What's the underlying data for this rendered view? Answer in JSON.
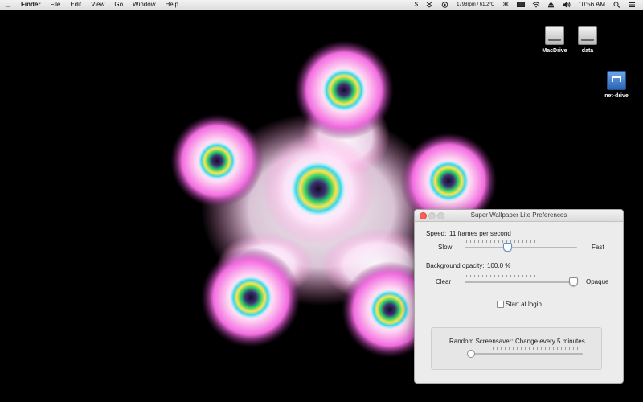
{
  "menubar": {
    "app_name": "Finder",
    "menus": [
      "File",
      "Edit",
      "View",
      "Go",
      "Window",
      "Help"
    ],
    "status": {
      "fan_temp": "1798rpm / 61.2°C",
      "time": "10:56 AM"
    },
    "status_icons": [
      "dollar-icon",
      "dropbox-icon",
      "gpu-icon",
      "command-icon",
      "screen-icon",
      "wifi-icon",
      "eject-icon",
      "volume-icon",
      "search-icon",
      "list-icon"
    ]
  },
  "desktop": {
    "icons": [
      {
        "label": "MacDrive",
        "icon": "drive-icon"
      },
      {
        "label": "data",
        "icon": "drive-icon"
      },
      {
        "label": "net-drive",
        "icon": "network-drive-icon"
      }
    ]
  },
  "preferences": {
    "title": "Super Wallpaper Lite Preferences",
    "speed_label": "Speed:",
    "speed_value": "11 frames per second",
    "speed_min": "Slow",
    "speed_max": "Fast",
    "speed_level": 0.37,
    "opacity_label": "Background opacity:",
    "opacity_value": "100.0 %",
    "opacity_min": "Clear",
    "opacity_max": "Opaque",
    "opacity_level": 1.0,
    "start_at_login": "Start at login",
    "start_at_login_checked": false,
    "random_label": "Random Screensaver:",
    "random_value": "Change every 5 minutes",
    "random_level": 0.0
  },
  "colors": {
    "desktop_bg": "#000000",
    "close_button": "#ff5f57",
    "slider_accent": "#5b8fd9"
  }
}
